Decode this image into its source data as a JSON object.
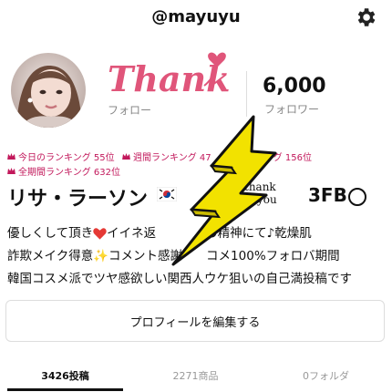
{
  "header": {
    "username": "@mayuyu"
  },
  "profile": {
    "sticker_text": "Thanks",
    "follow_label": "フォロー",
    "followers_count": "6,000",
    "followers_label": "フォロワー",
    "display_name": "リサ・ラーソン",
    "thankyou_1": "thank",
    "thankyou_2": "you",
    "name_suffix": "3FB"
  },
  "rankings": {
    "today": "今日のランキング 55位",
    "week": "週間ランキング 47",
    "month": "ランキング 156位",
    "all_time": "全期間ランキング 632位"
  },
  "bio": {
    "line1_a": "優しくして頂き",
    "line1_b": "イイネ返",
    "line1_c": "の精神にて",
    "line1_d": "乾燥肌",
    "line2_a": "詐欺メイク得意",
    "line2_b": "コメント感謝",
    "line2_c": "コメ100%フォロバ期間",
    "line3": "韓国コスメ派でツヤ感欲しい関西人ウケ狙いの自己満投稿です"
  },
  "actions": {
    "edit_profile": "プロフィールを編集する"
  },
  "tabs": [
    {
      "label": "3426投稿"
    },
    {
      "label": "2271商品"
    },
    {
      "label": "0フォルダ"
    }
  ],
  "colors": {
    "accent": "#e0557a",
    "ranking": "#c2185b",
    "lightning": "#f2e200"
  },
  "icons": [
    "gear-icon",
    "crown-icon",
    "heart-icon",
    "sparkle-icon",
    "music-note-icon",
    "flag-kr-icon",
    "lightning-sticker"
  ]
}
